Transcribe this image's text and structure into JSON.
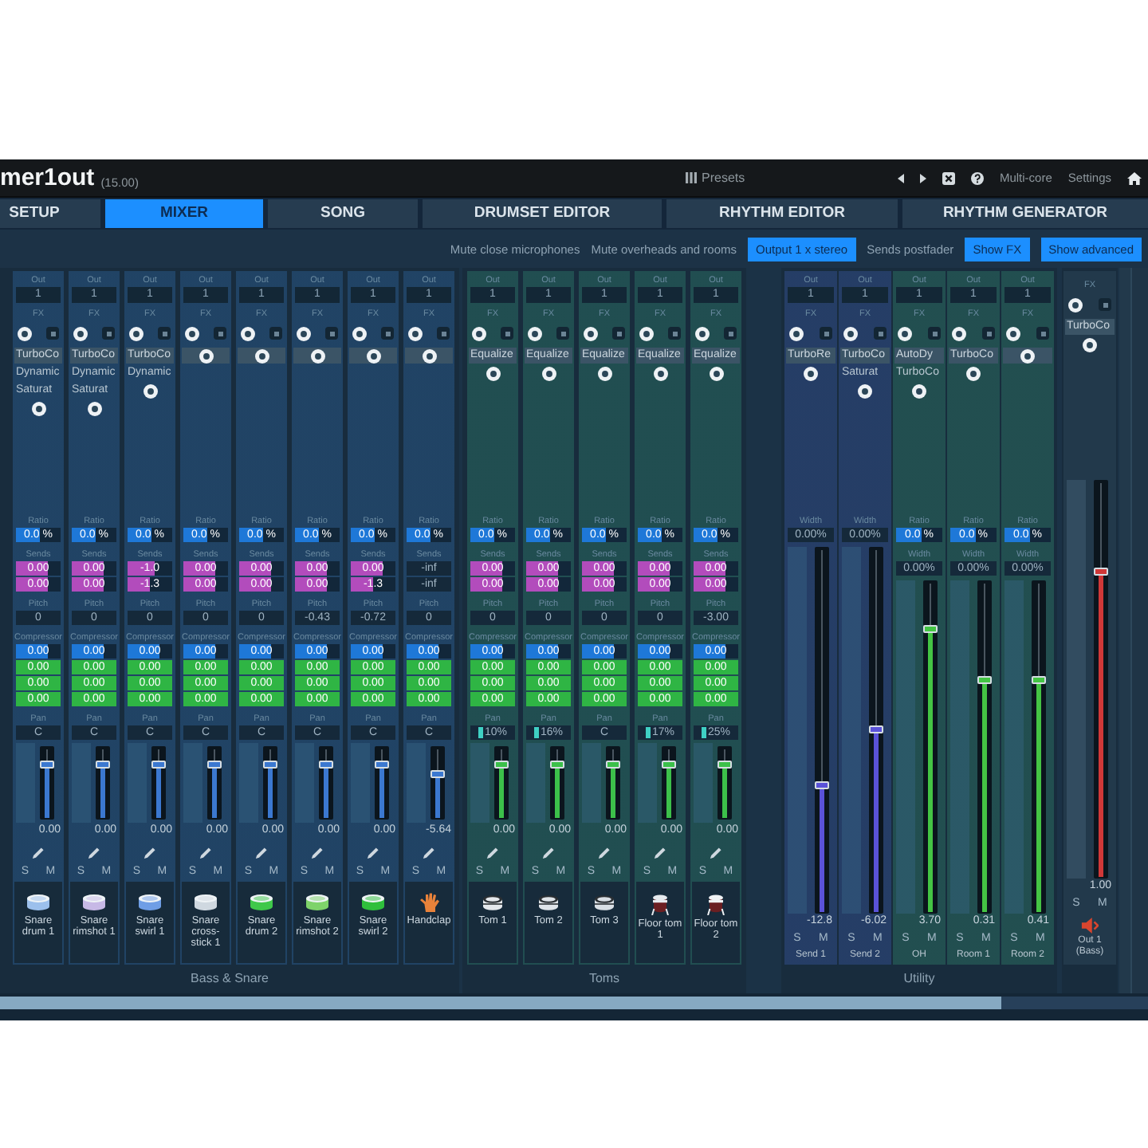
{
  "title_bar": {
    "app_name": "mer1out",
    "version": "(15.00)",
    "presets": "Presets",
    "multicore": "Multi-core",
    "settings": "Settings"
  },
  "tabs": [
    {
      "label": "SETUP",
      "selected": false
    },
    {
      "label": "MIXER",
      "selected": true
    },
    {
      "label": "SONG",
      "selected": false
    },
    {
      "label": "DRUMSET EDITOR",
      "selected": false
    },
    {
      "label": "RHYTHM EDITOR",
      "selected": false
    },
    {
      "label": "RHYTHM GENERATOR",
      "selected": false
    }
  ],
  "toolbar": [
    {
      "label": "Mute close microphones",
      "on": false
    },
    {
      "label": "Mute overheads and rooms",
      "on": false
    },
    {
      "label": "Output 1 x stereo",
      "on": true
    },
    {
      "label": "Sends postfader",
      "on": false
    },
    {
      "label": "Show FX",
      "on": true
    },
    {
      "label": "Show advanced",
      "on": true
    }
  ],
  "groups": [
    {
      "label": "Bass & Snare",
      "channels": [
        {
          "kind": "instrument",
          "name": "Snare drum 1",
          "out_label": "Out",
          "out": "1",
          "fx_label": "FX",
          "inserts": [
            "TurboCo",
            "Dynamic",
            "Saturat"
          ],
          "sections": [
            {
              "label": "Ratio",
              "rows": [
                {
                  "kind": "bar",
                  "value": "0.0 %",
                  "level": 0.55,
                  "color": "#1e78d8"
                }
              ]
            },
            {
              "label": "Sends",
              "rows": [
                {
                  "kind": "bar",
                  "value": "0.00",
                  "level": 0.7,
                  "color": "#b24cbc"
                },
                {
                  "kind": "bar",
                  "value": "0.00",
                  "level": 0.7,
                  "color": "#b24cbc"
                }
              ]
            },
            {
              "label": "Pitch",
              "rows": [
                {
                  "kind": "text",
                  "value": "0"
                }
              ]
            },
            {
              "label": "Compressor",
              "rows": [
                {
                  "kind": "bar",
                  "value": "0.00",
                  "level": 0.7,
                  "color": "#1e78d8"
                },
                {
                  "kind": "bar",
                  "value": "0.00",
                  "level": 1,
                  "color": "#2fb544"
                },
                {
                  "kind": "bar",
                  "value": "0.00",
                  "level": 1,
                  "color": "#2fb544"
                },
                {
                  "kind": "bar",
                  "value": "0.00",
                  "level": 1,
                  "color": "#2fb544"
                }
              ]
            },
            {
              "label": "Pan",
              "rows": [
                {
                  "kind": "text",
                  "value": "C"
                }
              ]
            }
          ],
          "color": "#3b78d0",
          "level": 0.75,
          "gain": "0.00",
          "solo": "S",
          "mute": "M",
          "icon": {
            "kind": "snare",
            "color": "#9cc0ec"
          }
        },
        {
          "kind": "instrument",
          "name": "Snare rimshot 1",
          "out_label": "Out",
          "out": "1",
          "fx_label": "FX",
          "inserts": [
            "TurboCo",
            "Dynamic",
            "Saturat"
          ],
          "sections": [
            {
              "label": "Ratio",
              "rows": [
                {
                  "kind": "bar",
                  "value": "0.0 %",
                  "level": 0.55,
                  "color": "#1e78d8"
                }
              ]
            },
            {
              "label": "Sends",
              "rows": [
                {
                  "kind": "bar",
                  "value": "0.00",
                  "level": 0.7,
                  "color": "#b24cbc"
                },
                {
                  "kind": "bar",
                  "value": "0.00",
                  "level": 0.7,
                  "color": "#b24cbc"
                }
              ]
            },
            {
              "label": "Pitch",
              "rows": [
                {
                  "kind": "text",
                  "value": "0"
                }
              ]
            },
            {
              "label": "Compressor",
              "rows": [
                {
                  "kind": "bar",
                  "value": "0.00",
                  "level": 0.7,
                  "color": "#1e78d8"
                },
                {
                  "kind": "bar",
                  "value": "0.00",
                  "level": 1,
                  "color": "#2fb544"
                },
                {
                  "kind": "bar",
                  "value": "0.00",
                  "level": 1,
                  "color": "#2fb544"
                },
                {
                  "kind": "bar",
                  "value": "0.00",
                  "level": 1,
                  "color": "#2fb544"
                }
              ]
            },
            {
              "label": "Pan",
              "rows": [
                {
                  "kind": "text",
                  "value": "C"
                }
              ]
            }
          ],
          "color": "#3b78d0",
          "level": 0.75,
          "gain": "0.00",
          "solo": "S",
          "mute": "M",
          "icon": {
            "kind": "snare",
            "color": "#c7b9e6"
          }
        },
        {
          "kind": "instrument",
          "name": "Snare swirl 1",
          "out_label": "Out",
          "out": "1",
          "fx_label": "FX",
          "inserts": [
            "TurboCo",
            "Dynamic"
          ],
          "sections": [
            {
              "label": "Ratio",
              "rows": [
                {
                  "kind": "bar",
                  "value": "0.0 %",
                  "level": 0.55,
                  "color": "#1e78d8"
                }
              ]
            },
            {
              "label": "Sends",
              "rows": [
                {
                  "kind": "bar",
                  "value": "-1.0",
                  "level": 0.6,
                  "color": "#b24cbc"
                },
                {
                  "kind": "bar",
                  "value": "-1.3",
                  "level": 0.5,
                  "color": "#b24cbc"
                }
              ]
            },
            {
              "label": "Pitch",
              "rows": [
                {
                  "kind": "text",
                  "value": "0"
                }
              ]
            },
            {
              "label": "Compressor",
              "rows": [
                {
                  "kind": "bar",
                  "value": "0.00",
                  "level": 0.7,
                  "color": "#1e78d8"
                },
                {
                  "kind": "bar",
                  "value": "0.00",
                  "level": 1,
                  "color": "#2fb544"
                },
                {
                  "kind": "bar",
                  "value": "0.00",
                  "level": 1,
                  "color": "#2fb544"
                },
                {
                  "kind": "bar",
                  "value": "0.00",
                  "level": 1,
                  "color": "#2fb544"
                }
              ]
            },
            {
              "label": "Pan",
              "rows": [
                {
                  "kind": "text",
                  "value": "C"
                }
              ]
            }
          ],
          "color": "#3b78d0",
          "level": 0.75,
          "gain": "0.00",
          "solo": "S",
          "mute": "M",
          "icon": {
            "kind": "snare",
            "color": "#6f9ee6"
          }
        },
        {
          "kind": "instrument",
          "name": "Snare cross-stick 1",
          "out_label": "Out",
          "out": "1",
          "fx_label": "FX",
          "sections": [
            {
              "label": "Ratio",
              "rows": [
                {
                  "kind": "bar",
                  "value": "0.0 %",
                  "level": 0.55,
                  "color": "#1e78d8"
                }
              ]
            },
            {
              "label": "Sends",
              "rows": [
                {
                  "kind": "bar",
                  "value": "0.00",
                  "level": 0.7,
                  "color": "#b24cbc"
                },
                {
                  "kind": "bar",
                  "value": "0.00",
                  "level": 0.7,
                  "color": "#b24cbc"
                }
              ]
            },
            {
              "label": "Pitch",
              "rows": [
                {
                  "kind": "text",
                  "value": "0"
                }
              ]
            },
            {
              "label": "Compressor",
              "rows": [
                {
                  "kind": "bar",
                  "value": "0.00",
                  "level": 0.7,
                  "color": "#1e78d8"
                },
                {
                  "kind": "bar",
                  "value": "0.00",
                  "level": 1,
                  "color": "#2fb544"
                },
                {
                  "kind": "bar",
                  "value": "0.00",
                  "level": 1,
                  "color": "#2fb544"
                },
                {
                  "kind": "bar",
                  "value": "0.00",
                  "level": 1,
                  "color": "#2fb544"
                }
              ]
            },
            {
              "label": "Pan",
              "rows": [
                {
                  "kind": "text",
                  "value": "C"
                }
              ]
            }
          ],
          "color": "#3b78d0",
          "level": 0.75,
          "gain": "0.00",
          "solo": "S",
          "mute": "M",
          "icon": {
            "kind": "snare",
            "color": "#cfd8e0"
          }
        },
        {
          "kind": "instrument",
          "name": "Snare drum 2",
          "out_label": "Out",
          "out": "1",
          "fx_label": "FX",
          "sections": [
            {
              "label": "Ratio",
              "rows": [
                {
                  "kind": "bar",
                  "value": "0.0 %",
                  "level": 0.55,
                  "color": "#1e78d8"
                }
              ]
            },
            {
              "label": "Sends",
              "rows": [
                {
                  "kind": "bar",
                  "value": "0.00",
                  "level": 0.7,
                  "color": "#b24cbc"
                },
                {
                  "kind": "bar",
                  "value": "0.00",
                  "level": 0.7,
                  "color": "#b24cbc"
                }
              ]
            },
            {
              "label": "Pitch",
              "rows": [
                {
                  "kind": "text",
                  "value": "0"
                }
              ]
            },
            {
              "label": "Compressor",
              "rows": [
                {
                  "kind": "bar",
                  "value": "0.00",
                  "level": 0.7,
                  "color": "#1e78d8"
                },
                {
                  "kind": "bar",
                  "value": "0.00",
                  "level": 1,
                  "color": "#2fb544"
                },
                {
                  "kind": "bar",
                  "value": "0.00",
                  "level": 1,
                  "color": "#2fb544"
                },
                {
                  "kind": "bar",
                  "value": "0.00",
                  "level": 1,
                  "color": "#2fb544"
                }
              ]
            },
            {
              "label": "Pan",
              "rows": [
                {
                  "kind": "text",
                  "value": "C"
                }
              ]
            }
          ],
          "color": "#3b78d0",
          "level": 0.75,
          "gain": "0.00",
          "solo": "S",
          "mute": "M",
          "icon": {
            "kind": "snare",
            "color": "#3fc84a"
          }
        },
        {
          "kind": "instrument",
          "name": "Snare rimshot 2",
          "out_label": "Out",
          "out": "1",
          "fx_label": "FX",
          "sections": [
            {
              "label": "Ratio",
              "rows": [
                {
                  "kind": "bar",
                  "value": "0.0 %",
                  "level": 0.55,
                  "color": "#1e78d8"
                }
              ]
            },
            {
              "label": "Sends",
              "rows": [
                {
                  "kind": "bar",
                  "value": "0.00",
                  "level": 0.7,
                  "color": "#b24cbc"
                },
                {
                  "kind": "bar",
                  "value": "0.00",
                  "level": 0.7,
                  "color": "#b24cbc"
                }
              ]
            },
            {
              "label": "Pitch",
              "rows": [
                {
                  "kind": "text",
                  "value": "-0.43"
                }
              ]
            },
            {
              "label": "Compressor",
              "rows": [
                {
                  "kind": "bar",
                  "value": "0.00",
                  "level": 0.7,
                  "color": "#1e78d8"
                },
                {
                  "kind": "bar",
                  "value": "0.00",
                  "level": 1,
                  "color": "#2fb544"
                },
                {
                  "kind": "bar",
                  "value": "0.00",
                  "level": 1,
                  "color": "#2fb544"
                },
                {
                  "kind": "bar",
                  "value": "0.00",
                  "level": 1,
                  "color": "#2fb544"
                }
              ]
            },
            {
              "label": "Pan",
              "rows": [
                {
                  "kind": "text",
                  "value": "C"
                }
              ]
            }
          ],
          "color": "#3b78d0",
          "level": 0.75,
          "gain": "0.00",
          "solo": "S",
          "mute": "M",
          "icon": {
            "kind": "snare",
            "color": "#7ed36a"
          }
        },
        {
          "kind": "instrument",
          "name": "Snare swirl 2",
          "out_label": "Out",
          "out": "1",
          "fx_label": "FX",
          "sections": [
            {
              "label": "Ratio",
              "rows": [
                {
                  "kind": "bar",
                  "value": "0.0 %",
                  "level": 0.55,
                  "color": "#1e78d8"
                }
              ]
            },
            {
              "label": "Sends",
              "rows": [
                {
                  "kind": "bar",
                  "value": "0.00",
                  "level": 0.7,
                  "color": "#b24cbc"
                },
                {
                  "kind": "bar",
                  "value": "-1.3",
                  "level": 0.5,
                  "color": "#b24cbc"
                }
              ]
            },
            {
              "label": "Pitch",
              "rows": [
                {
                  "kind": "text",
                  "value": "-0.72"
                }
              ]
            },
            {
              "label": "Compressor",
              "rows": [
                {
                  "kind": "bar",
                  "value": "0.00",
                  "level": 0.7,
                  "color": "#1e78d8"
                },
                {
                  "kind": "bar",
                  "value": "0.00",
                  "level": 1,
                  "color": "#2fb544"
                },
                {
                  "kind": "bar",
                  "value": "0.00",
                  "level": 1,
                  "color": "#2fb544"
                },
                {
                  "kind": "bar",
                  "value": "0.00",
                  "level": 1,
                  "color": "#2fb544"
                }
              ]
            },
            {
              "label": "Pan",
              "rows": [
                {
                  "kind": "text",
                  "value": "C"
                }
              ]
            }
          ],
          "color": "#3b78d0",
          "level": 0.75,
          "gain": "0.00",
          "solo": "S",
          "mute": "M",
          "icon": {
            "kind": "snare",
            "color": "#2fbf3c"
          }
        },
        {
          "kind": "instrument",
          "name": "Handclap",
          "out_label": "Out",
          "out": "1",
          "fx_label": "FX",
          "sections": [
            {
              "label": "Ratio",
              "rows": [
                {
                  "kind": "bar",
                  "value": "0.0 %",
                  "level": 0.55,
                  "color": "#1e78d8"
                }
              ]
            },
            {
              "label": "Sends",
              "rows": [
                {
                  "kind": "text",
                  "value": "-inf"
                },
                {
                  "kind": "text",
                  "value": "-inf"
                }
              ]
            },
            {
              "label": "Pitch",
              "rows": [
                {
                  "kind": "text",
                  "value": "0"
                }
              ]
            },
            {
              "label": "Compressor",
              "rows": [
                {
                  "kind": "bar",
                  "value": "0.00",
                  "level": 0.7,
                  "color": "#1e78d8"
                },
                {
                  "kind": "bar",
                  "value": "0.00",
                  "level": 1,
                  "color": "#2fb544"
                },
                {
                  "kind": "bar",
                  "value": "0.00",
                  "level": 1,
                  "color": "#2fb544"
                },
                {
                  "kind": "bar",
                  "value": "0.00",
                  "level": 1,
                  "color": "#2fb544"
                }
              ]
            },
            {
              "label": "Pan",
              "rows": [
                {
                  "kind": "text",
                  "value": "C"
                }
              ]
            }
          ],
          "color": "#3b78d0",
          "level": 0.6,
          "gain": "-5.64",
          "solo": "S",
          "mute": "M",
          "icon": {
            "kind": "hand",
            "color": "#e8823a"
          }
        }
      ]
    },
    {
      "label": "Toms",
      "channels": [
        {
          "kind": "instrument",
          "name": "Tom 1",
          "out_label": "Out",
          "out": "1",
          "fx_label": "FX",
          "inserts": [
            "Equalize"
          ],
          "sections": [
            {
              "label": "Ratio",
              "rows": [
                {
                  "kind": "bar",
                  "value": "0.0 %",
                  "level": 0.55,
                  "color": "#1e78d8"
                }
              ]
            },
            {
              "label": "Sends",
              "rows": [
                {
                  "kind": "bar",
                  "value": "0.00",
                  "level": 0.7,
                  "color": "#b24cbc"
                },
                {
                  "kind": "bar",
                  "value": "0.00",
                  "level": 0.7,
                  "color": "#b24cbc"
                }
              ]
            },
            {
              "label": "Pitch",
              "rows": [
                {
                  "kind": "text",
                  "value": "0"
                }
              ]
            },
            {
              "label": "Compressor",
              "rows": [
                {
                  "kind": "bar",
                  "value": "0.00",
                  "level": 0.7,
                  "color": "#1e78d8"
                },
                {
                  "kind": "bar",
                  "value": "0.00",
                  "level": 1,
                  "color": "#2fb544"
                },
                {
                  "kind": "bar",
                  "value": "0.00",
                  "level": 1,
                  "color": "#2fb544"
                },
                {
                  "kind": "bar",
                  "value": "0.00",
                  "level": 1,
                  "color": "#2fb544"
                }
              ]
            },
            {
              "label": "Pan",
              "rows": [
                {
                  "kind": "marker",
                  "value": "10%"
                }
              ]
            }
          ],
          "color": "#3cc04a",
          "level": 0.75,
          "gain": "0.00",
          "solo": "S",
          "mute": "M",
          "icon": {
            "kind": "tom",
            "color": "#e4e8ec"
          }
        },
        {
          "kind": "instrument",
          "name": "Tom 2",
          "out_label": "Out",
          "out": "1",
          "fx_label": "FX",
          "inserts": [
            "Equalize"
          ],
          "sections": [
            {
              "label": "Ratio",
              "rows": [
                {
                  "kind": "bar",
                  "value": "0.0 %",
                  "level": 0.55,
                  "color": "#1e78d8"
                }
              ]
            },
            {
              "label": "Sends",
              "rows": [
                {
                  "kind": "bar",
                  "value": "0.00",
                  "level": 0.7,
                  "color": "#b24cbc"
                },
                {
                  "kind": "bar",
                  "value": "0.00",
                  "level": 0.7,
                  "color": "#b24cbc"
                }
              ]
            },
            {
              "label": "Pitch",
              "rows": [
                {
                  "kind": "text",
                  "value": "0"
                }
              ]
            },
            {
              "label": "Compressor",
              "rows": [
                {
                  "kind": "bar",
                  "value": "0.00",
                  "level": 0.7,
                  "color": "#1e78d8"
                },
                {
                  "kind": "bar",
                  "value": "0.00",
                  "level": 1,
                  "color": "#2fb544"
                },
                {
                  "kind": "bar",
                  "value": "0.00",
                  "level": 1,
                  "color": "#2fb544"
                },
                {
                  "kind": "bar",
                  "value": "0.00",
                  "level": 1,
                  "color": "#2fb544"
                }
              ]
            },
            {
              "label": "Pan",
              "rows": [
                {
                  "kind": "marker",
                  "value": "16%"
                }
              ]
            }
          ],
          "color": "#3cc04a",
          "level": 0.75,
          "gain": "0.00",
          "solo": "S",
          "mute": "M",
          "icon": {
            "kind": "tom",
            "color": "#dfe4e9"
          }
        },
        {
          "kind": "instrument",
          "name": "Tom 3",
          "out_label": "Out",
          "out": "1",
          "fx_label": "FX",
          "inserts": [
            "Equalize"
          ],
          "sections": [
            {
              "label": "Ratio",
              "rows": [
                {
                  "kind": "bar",
                  "value": "0.0 %",
                  "level": 0.55,
                  "color": "#1e78d8"
                }
              ]
            },
            {
              "label": "Sends",
              "rows": [
                {
                  "kind": "bar",
                  "value": "0.00",
                  "level": 0.7,
                  "color": "#b24cbc"
                },
                {
                  "kind": "bar",
                  "value": "0.00",
                  "level": 0.7,
                  "color": "#b24cbc"
                }
              ]
            },
            {
              "label": "Pitch",
              "rows": [
                {
                  "kind": "text",
                  "value": "0"
                }
              ]
            },
            {
              "label": "Compressor",
              "rows": [
                {
                  "kind": "bar",
                  "value": "0.00",
                  "level": 0.7,
                  "color": "#1e78d8"
                },
                {
                  "kind": "bar",
                  "value": "0.00",
                  "level": 1,
                  "color": "#2fb544"
                },
                {
                  "kind": "bar",
                  "value": "0.00",
                  "level": 1,
                  "color": "#2fb544"
                },
                {
                  "kind": "bar",
                  "value": "0.00",
                  "level": 1,
                  "color": "#2fb544"
                }
              ]
            },
            {
              "label": "Pan",
              "rows": [
                {
                  "kind": "text",
                  "value": "C"
                }
              ]
            }
          ],
          "color": "#3cc04a",
          "level": 0.75,
          "gain": "0.00",
          "solo": "S",
          "mute": "M",
          "icon": {
            "kind": "tom",
            "color": "#d9dfe5"
          }
        },
        {
          "kind": "instrument",
          "name": "Floor tom 1",
          "out_label": "Out",
          "out": "1",
          "fx_label": "FX",
          "inserts": [
            "Equalize"
          ],
          "sections": [
            {
              "label": "Ratio",
              "rows": [
                {
                  "kind": "bar",
                  "value": "0.0 %",
                  "level": 0.55,
                  "color": "#1e78d8"
                }
              ]
            },
            {
              "label": "Sends",
              "rows": [
                {
                  "kind": "bar",
                  "value": "0.00",
                  "level": 0.7,
                  "color": "#b24cbc"
                },
                {
                  "kind": "bar",
                  "value": "0.00",
                  "level": 0.7,
                  "color": "#b24cbc"
                }
              ]
            },
            {
              "label": "Pitch",
              "rows": [
                {
                  "kind": "text",
                  "value": "0"
                }
              ]
            },
            {
              "label": "Compressor",
              "rows": [
                {
                  "kind": "bar",
                  "value": "0.00",
                  "level": 0.7,
                  "color": "#1e78d8"
                },
                {
                  "kind": "bar",
                  "value": "0.00",
                  "level": 1,
                  "color": "#2fb544"
                },
                {
                  "kind": "bar",
                  "value": "0.00",
                  "level": 1,
                  "color": "#2fb544"
                },
                {
                  "kind": "bar",
                  "value": "0.00",
                  "level": 1,
                  "color": "#2fb544"
                }
              ]
            },
            {
              "label": "Pan",
              "rows": [
                {
                  "kind": "marker",
                  "value": "17%"
                }
              ]
            }
          ],
          "color": "#3cc04a",
          "level": 0.75,
          "gain": "0.00",
          "solo": "S",
          "mute": "M",
          "icon": {
            "kind": "floor_tom",
            "color": "#e6eaee"
          }
        },
        {
          "kind": "instrument",
          "name": "Floor tom 2",
          "out_label": "Out",
          "out": "1",
          "fx_label": "FX",
          "inserts": [
            "Equalize"
          ],
          "sections": [
            {
              "label": "Ratio",
              "rows": [
                {
                  "kind": "bar",
                  "value": "0.0 %",
                  "level": 0.55,
                  "color": "#1e78d8"
                }
              ]
            },
            {
              "label": "Sends",
              "rows": [
                {
                  "kind": "bar",
                  "value": "0.00",
                  "level": 0.7,
                  "color": "#b24cbc"
                },
                {
                  "kind": "bar",
                  "value": "0.00",
                  "level": 0.7,
                  "color": "#b24cbc"
                }
              ]
            },
            {
              "label": "Pitch",
              "rows": [
                {
                  "kind": "text",
                  "value": "-3.00"
                }
              ]
            },
            {
              "label": "Compressor",
              "rows": [
                {
                  "kind": "bar",
                  "value": "0.00",
                  "level": 0.7,
                  "color": "#1e78d8"
                },
                {
                  "kind": "bar",
                  "value": "0.00",
                  "level": 1,
                  "color": "#2fb544"
                },
                {
                  "kind": "bar",
                  "value": "0.00",
                  "level": 1,
                  "color": "#2fb544"
                },
                {
                  "kind": "bar",
                  "value": "0.00",
                  "level": 1,
                  "color": "#2fb544"
                }
              ]
            },
            {
              "label": "Pan",
              "rows": [
                {
                  "kind": "marker",
                  "value": "25%"
                }
              ]
            }
          ],
          "color": "#3cc04a",
          "level": 0.75,
          "gain": "0.00",
          "solo": "S",
          "mute": "M",
          "icon": {
            "kind": "floor_tom",
            "color": "#f0f2f4"
          }
        }
      ]
    },
    {
      "label": "Utility",
      "channels": [
        {
          "kind": "bus",
          "name": "Send 1",
          "out_label": "Out",
          "out": "1",
          "fx_label": "FX",
          "inserts": [
            "TurboRe"
          ],
          "sections": [
            {
              "label": "Width",
              "rows": [
                {
                  "kind": "text",
                  "value": "0.00%"
                }
              ]
            }
          ],
          "color": "#5a52d8",
          "level": 0.35,
          "gain": "-12.8",
          "solo": "S",
          "mute": "M"
        },
        {
          "kind": "bus",
          "name": "Send 2",
          "out_label": "Out",
          "out": "1",
          "fx_label": "FX",
          "inserts": [
            "TurboCo",
            "Saturat"
          ],
          "sections": [
            {
              "label": "Width",
              "rows": [
                {
                  "kind": "text",
                  "value": "0.00%"
                }
              ]
            }
          ],
          "color": "#5a52d8",
          "level": 0.5,
          "gain": "-6.02",
          "solo": "S",
          "mute": "M"
        },
        {
          "kind": "bus",
          "name": "OH",
          "out_label": "Out",
          "out": "1",
          "fx_label": "FX",
          "inserts": [
            "AutoDy",
            "TurboCo"
          ],
          "sections": [
            {
              "label": "Ratio",
              "rows": [
                {
                  "kind": "bar",
                  "value": "0.0 %",
                  "level": 0.55,
                  "color": "#1e78d8"
                }
              ]
            },
            {
              "label": "Width",
              "rows": [
                {
                  "kind": "text",
                  "value": "0.00%"
                }
              ]
            }
          ],
          "color": "#44c444",
          "level": 0.85,
          "gain": "3.70",
          "solo": "S",
          "mute": "M"
        },
        {
          "kind": "bus",
          "name": "Room 1",
          "out_label": "Out",
          "out": "1",
          "fx_label": "FX",
          "inserts": [
            "TurboCo"
          ],
          "sections": [
            {
              "label": "Ratio",
              "rows": [
                {
                  "kind": "bar",
                  "value": "0.0 %",
                  "level": 0.55,
                  "color": "#1e78d8"
                }
              ]
            },
            {
              "label": "Width",
              "rows": [
                {
                  "kind": "text",
                  "value": "0.00%"
                }
              ]
            }
          ],
          "color": "#44c444",
          "level": 0.7,
          "gain": "0.31",
          "solo": "S",
          "mute": "M"
        },
        {
          "kind": "bus",
          "name": "Room 2",
          "out_label": "Out",
          "out": "1",
          "fx_label": "FX",
          "sections": [
            {
              "label": "Ratio",
              "rows": [
                {
                  "kind": "bar",
                  "value": "0.0 %",
                  "level": 0.55,
                  "color": "#1e78d8"
                }
              ]
            },
            {
              "label": "Width",
              "rows": [
                {
                  "kind": "text",
                  "value": "0.00%"
                }
              ]
            }
          ],
          "color": "#44c444",
          "level": 0.7,
          "gain": "0.41",
          "solo": "S",
          "mute": "M"
        }
      ]
    },
    {
      "channels": [
        {
          "kind": "output",
          "name": "Out 1 (Bass)",
          "fx_label": "FX",
          "inserts": [
            "TurboCo"
          ],
          "color": "#d03838",
          "level": 0.77,
          "gain": "1.00",
          "solo": "S",
          "mute": "M",
          "icon": {
            "kind": "speaker",
            "color": "#d8452e"
          }
        }
      ]
    }
  ]
}
